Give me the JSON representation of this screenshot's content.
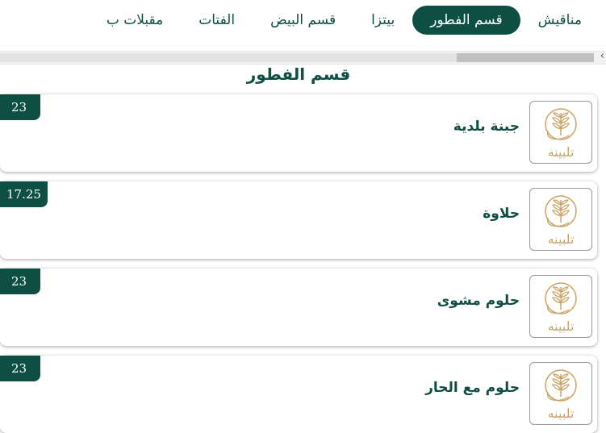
{
  "tabs": [
    {
      "label": "مناقيش",
      "active": false
    },
    {
      "label": "قسم الفطور",
      "active": true
    },
    {
      "label": "بيتزا",
      "active": false
    },
    {
      "label": "قسم البيض",
      "active": false
    },
    {
      "label": "الفتات",
      "active": false
    },
    {
      "label": "مقبلات ب",
      "active": false
    }
  ],
  "section": {
    "title": "قسم الفطور"
  },
  "logo": {
    "text": "تلبينه",
    "icon": "wheat-logo-icon"
  },
  "items": [
    {
      "name": "جبنة بلدية",
      "price": "23"
    },
    {
      "name": "حلاوة",
      "price": "17.25"
    },
    {
      "name": "حلوم مشوى",
      "price": "23"
    },
    {
      "name": "حلوم مع الحار",
      "price": "23"
    }
  ],
  "colors": {
    "primary": "#0e4f45",
    "logo_gold": "#c8a567"
  }
}
